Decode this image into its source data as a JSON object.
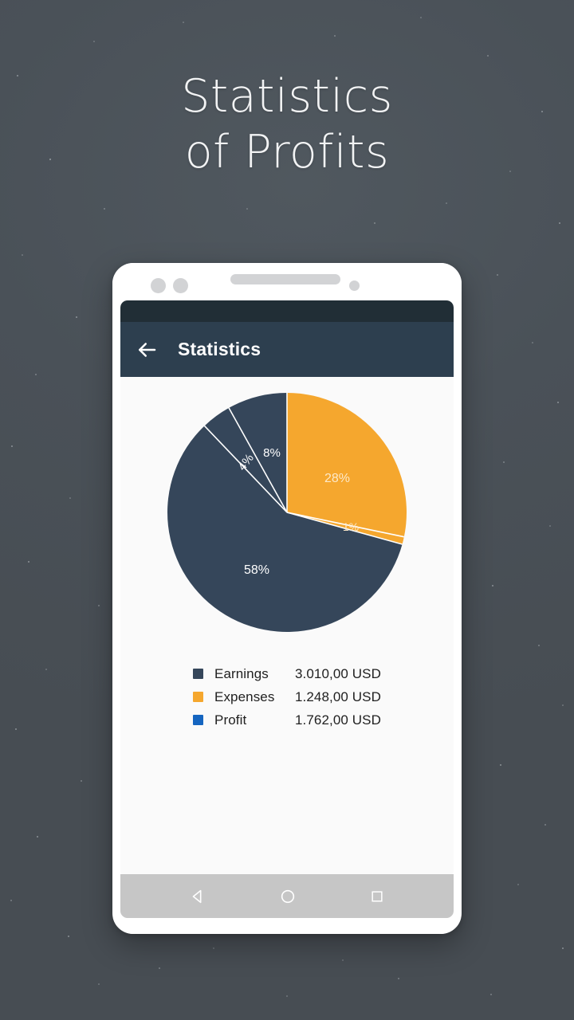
{
  "hero": {
    "line1": "Statistics",
    "line2": "of Profits"
  },
  "phone": {
    "status_bar": {},
    "app_bar": {
      "back_icon": "arrow-left-icon",
      "title": "Statistics"
    },
    "nav_bar": {
      "back": "triangle-back-icon",
      "home": "circle-home-icon",
      "recents": "square-recents-icon"
    }
  },
  "colors": {
    "background": "#4a5158",
    "status_bar": "#212e36",
    "app_bar": "#2d3f4f",
    "screen": "#fafafa",
    "earnings": "#35465a",
    "expenses": "#f5a72e",
    "profit": "#1565c0",
    "nav_bar": "#c6c6c6",
    "hero_text": "#f2f3f4"
  },
  "legend": {
    "rows": [
      {
        "label": "Earnings",
        "value": "3.010,00 USD",
        "color": "#35465a"
      },
      {
        "label": "Expenses",
        "value": "1.248,00 USD",
        "color": "#f5a72e"
      },
      {
        "label": "Profit",
        "value": "1.762,00 USD",
        "color": "#1565c0"
      }
    ]
  },
  "chart_data": {
    "type": "pie",
    "title": "Statistics",
    "labels": [
      "28%",
      "1%",
      "58%",
      "4%",
      "8%"
    ],
    "values": [
      28,
      1,
      58,
      4,
      8
    ],
    "colors": [
      "#f5a72e",
      "#f5a72e",
      "#35465a",
      "#35465a",
      "#35465a"
    ],
    "slice_label_colors": [
      "#fde9c9",
      "#fde9c9",
      "#ffffff",
      "#ffffff",
      "#ffffff"
    ],
    "start_angle_deg": 0,
    "direction": "clockwise",
    "separator_color": "#ffffff",
    "legend_position": "bottom",
    "grid": false,
    "slices": [
      {
        "label": "28%",
        "value": 28,
        "color": "#f5a72e"
      },
      {
        "label": "1%",
        "value": 1,
        "color": "#f5a72e"
      },
      {
        "label": "58%",
        "value": 58,
        "color": "#35465a"
      },
      {
        "label": "4%",
        "value": 4,
        "color": "#35465a"
      },
      {
        "label": "8%",
        "value": 8,
        "color": "#35465a"
      }
    ]
  }
}
